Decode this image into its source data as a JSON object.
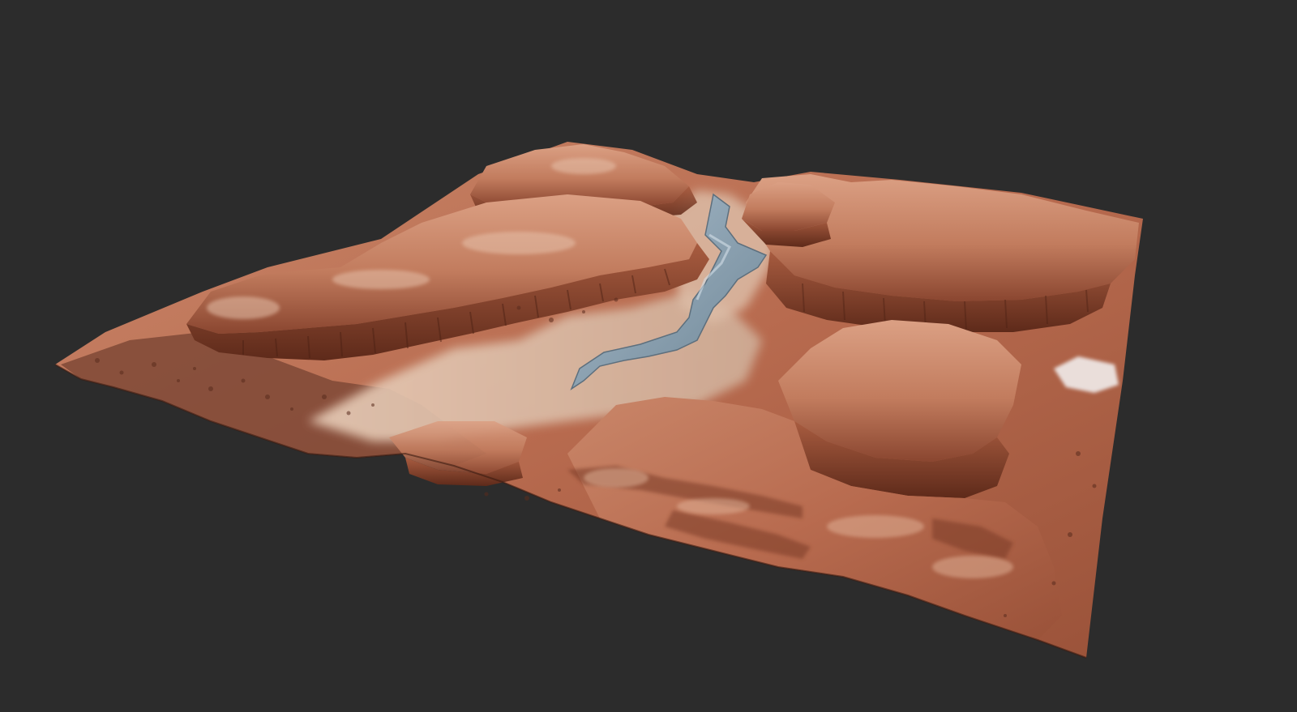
{
  "scene": {
    "background_color": "#2c2c2c",
    "subject": "terrain-render",
    "terrain_colors": {
      "rock_base": "#b86b4f",
      "rock_light": "#d99a7c",
      "rock_dark": "#7a3a26",
      "sand_pale": "#e2c3ad",
      "water": "#8fa4b3",
      "snow": "#f2efee"
    }
  }
}
